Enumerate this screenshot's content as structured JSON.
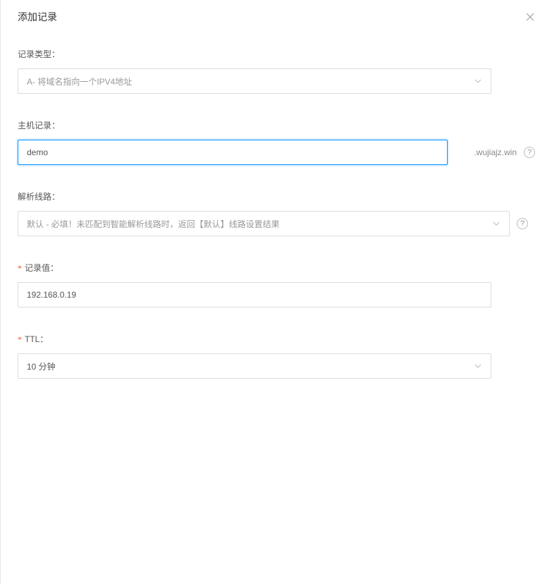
{
  "dialog": {
    "title": "添加记录"
  },
  "fields": {
    "record_type": {
      "label": "记录类型：",
      "value": "A- 将域名指向一个IPV4地址"
    },
    "host": {
      "label": "主机记录：",
      "value": "demo",
      "domain_suffix": ".wujiajz.win"
    },
    "line": {
      "label": "解析线路：",
      "value": "默认 - 必填！未匹配到智能解析线路时，返回【默认】线路设置结果"
    },
    "record_value": {
      "label": "记录值：",
      "value": "192.168.0.19"
    },
    "ttl": {
      "label": "TTL：",
      "value": "10 分钟"
    }
  },
  "icons": {
    "help": "?"
  }
}
